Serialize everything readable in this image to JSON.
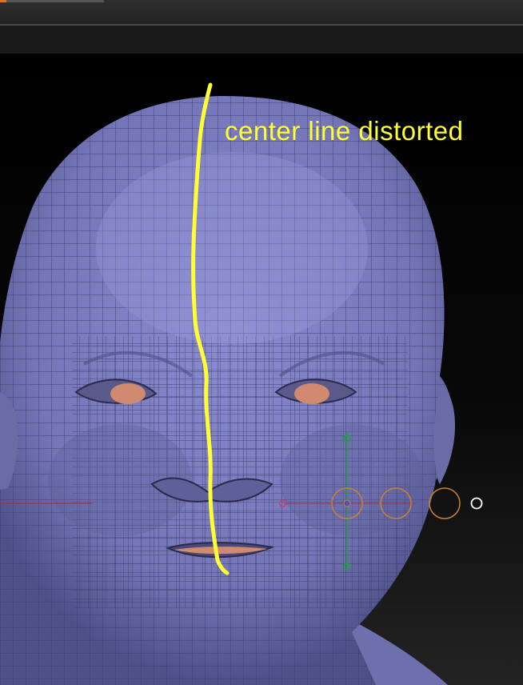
{
  "window": {
    "accent_color": "#e07020"
  },
  "viewport": {
    "subject": "head-mesh",
    "mesh_color": "#7f80c2",
    "wire_color": "#3a3a66",
    "annotation": {
      "text": "center line distorted",
      "color": "#ffff33"
    }
  },
  "gizmo": {
    "icons": [
      "move-gizmo-icon",
      "scale-ring-icon",
      "rotate-ring-icon",
      "pivot-circle-icon"
    ],
    "colors": {
      "x_axis": "#c02020",
      "y_axis": "#20a040",
      "rings": "#d08030"
    }
  }
}
